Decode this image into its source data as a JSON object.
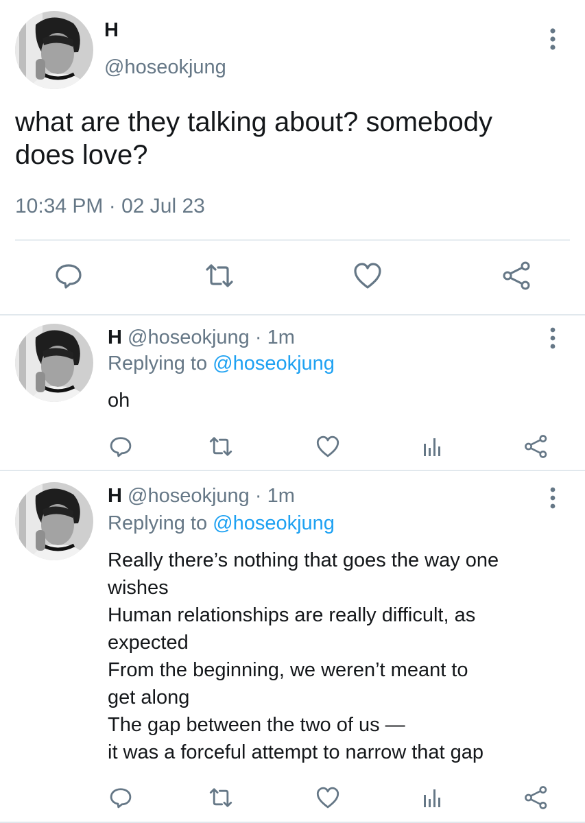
{
  "main_tweet": {
    "name": "H",
    "handle": "@hoseokjung",
    "text_lines": [
      "what are they talking about? somebody",
      "does love?"
    ],
    "timestamp": "10:34 PM · 02 Jul 23",
    "avatar": "profile-photo-grayscale",
    "actions": [
      "reply-icon",
      "retweet-icon",
      "like-icon",
      "share-icon"
    ]
  },
  "replies": [
    {
      "name": "H",
      "handle": "@hoseokjung",
      "dot": "·",
      "time": "1m",
      "replying_label": "Replying to",
      "replying_handle": "@hoseokjung",
      "lines": [
        "oh"
      ],
      "actions": [
        "reply-icon",
        "retweet-icon",
        "like-icon",
        "analytics-icon",
        "share-icon"
      ]
    },
    {
      "name": "H",
      "handle": "@hoseokjung",
      "dot": "·",
      "time": "1m",
      "replying_label": "Replying to",
      "replying_handle": "@hoseokjung",
      "lines": [
        "Really there’s nothing that goes the way one",
        "wishes",
        "Human relationships are really difficult, as",
        "expected",
        "From the beginning, we weren’t meant to",
        "get along",
        "The gap between the two of us —",
        "it was a forceful attempt to narrow that gap"
      ],
      "actions": [
        "reply-icon",
        "retweet-icon",
        "like-icon",
        "analytics-icon",
        "share-icon"
      ]
    }
  ],
  "colors": {
    "text": "#14171a",
    "secondary": "#657786",
    "link": "#1da1f2",
    "divider": "#e1e8ed"
  }
}
